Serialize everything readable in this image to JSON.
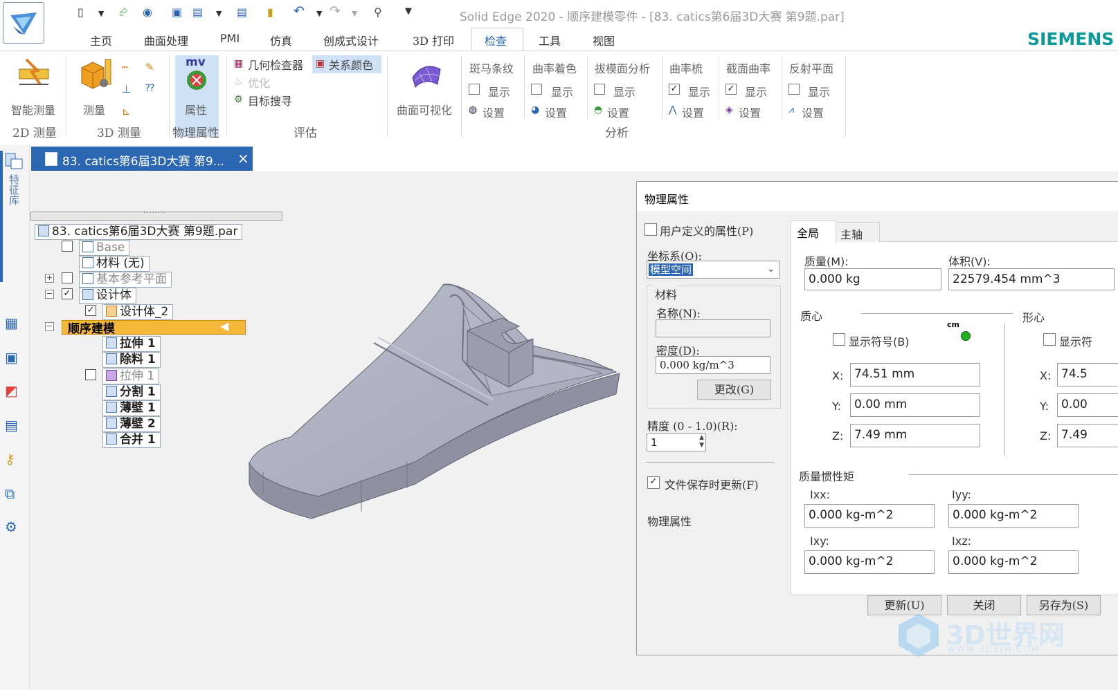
{
  "app": {
    "title": "Solid Edge 2020 - 顺序建模零件 - [83. catics第6届3D大赛 第9题.par]",
    "brand": "SIEMENS"
  },
  "tabs": [
    "主页",
    "曲面处理",
    "PMI",
    "仿真",
    "创成式设计",
    "3D 打印",
    "检查",
    "工具",
    "视图"
  ],
  "ribbon": {
    "smart_measure": "智能测量",
    "group_2d": "2D 测量",
    "measure": "测量",
    "group_3d": "3D 测量",
    "mv": "mv",
    "properties": "属性",
    "group_phys": "物理属性",
    "geo_checker": "几何检查器",
    "relation_color": "关系颜色",
    "optimize": "优化",
    "target_seek": "目标搜寻",
    "group_eval": "评估",
    "surface_vis": "曲面可视化",
    "zebra": "斑马条纹",
    "curv_shade": "曲率着色",
    "draft": "拔模面分析",
    "curv_comb": "曲率梳",
    "section_curv": "截面曲率",
    "reflect": "反射平面",
    "show": "显示",
    "settings": "设置",
    "group_analysis": "分析"
  },
  "doc_tab": {
    "label": "83. catics第6届3D大赛 第9...",
    "close": "×"
  },
  "side_label": "特征库",
  "tree": {
    "root": "83. catics第6届3D大赛 第9题.par",
    "base": "Base",
    "material": "材料 (无)",
    "ref_planes": "基本参考平面",
    "design_body": "设计体",
    "design_body_2": "设计体_2",
    "ordered": "顺序建模",
    "features": [
      "拉伸 1",
      "除料 1",
      "拉伸 1",
      "分割 1",
      "薄壁 1",
      "薄壁 2",
      "合并 1"
    ]
  },
  "dialog": {
    "title": "物理属性",
    "user_defined": "用户定义的属性(P)",
    "coord_label": "坐标系(O):",
    "coord_value": "模型空间",
    "material_group": "材料",
    "name_label": "名称(N):",
    "density_label": "密度(D):",
    "density_value": "0.000 kg/m^3",
    "change_btn": "更改(G)",
    "precision_label": "精度 (0 - 1.0)(R):",
    "precision_value": "1",
    "update_on_save": "文件保存时更新(F)",
    "phys_label": "物理属性",
    "tab_global": "全局",
    "tab_principal": "主轴",
    "mass_label": "质量(M):",
    "mass_value": "0.000 kg",
    "volume_label": "体积(V):",
    "volume_value": "22579.454 mm^3",
    "centroid": "质心",
    "shape_center": "形心",
    "show_symbol": "显示符号(B)",
    "show_symbol_2": "显示符",
    "cm_badge": "cm",
    "x_label": "X:",
    "y_label": "Y:",
    "z_label": "Z:",
    "cx": "74.51 mm",
    "cy": "0.00 mm",
    "cz": "7.49 mm",
    "sx": "74.5",
    "sy": "0.00",
    "sz": "7.49",
    "inertia": "质量惯性矩",
    "ixx_label": "Ixx:",
    "iyy_label": "Iyy:",
    "ixy_label": "Ixy:",
    "ixz_label": "Ixz:",
    "ixx": "0.000 kg-m^2",
    "iyy": "0.000 kg-m^2",
    "ixy": "0.000 kg-m^2",
    "ixz": "0.000 kg-m^2",
    "update_btn": "更新(U)",
    "close_btn": "关闭",
    "saveas_btn": "另存为(S)"
  },
  "watermark": {
    "text": "3D世界网",
    "url": "WWW.3DSJW.COM"
  },
  "colors": {
    "accent": "#2c67b4",
    "ordered_bar": "#f5b83a",
    "brand": "#0b9a9a",
    "part": "#a9acbb"
  }
}
